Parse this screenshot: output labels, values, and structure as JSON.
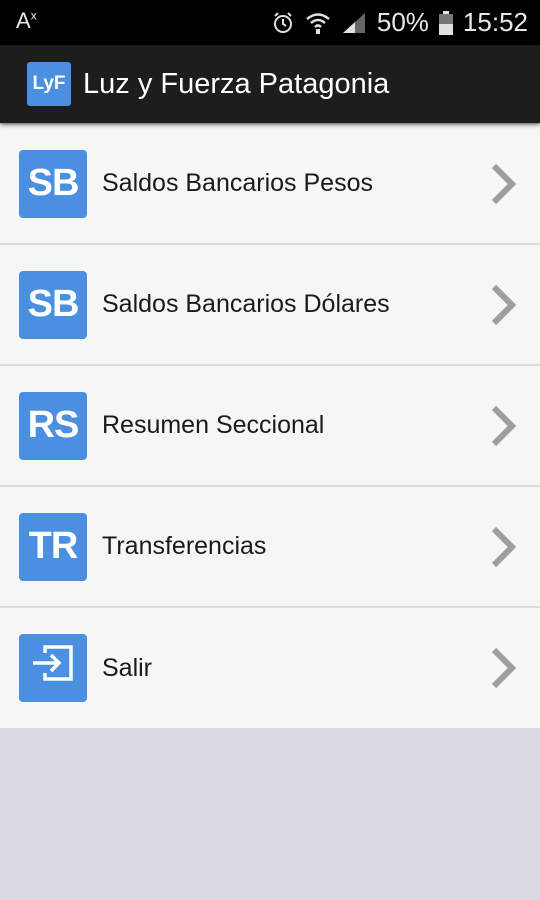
{
  "status_bar": {
    "left_indicator": "A",
    "left_indicator_sup": "x",
    "battery": "50%",
    "time": "15:52",
    "icons": [
      "alarm-icon",
      "wifi-icon",
      "signal-icon",
      "battery-icon"
    ]
  },
  "action_bar": {
    "logo_text": "LyF",
    "title": "Luz y Fuerza Patagonia"
  },
  "menu": {
    "items": [
      {
        "badge": "SB",
        "label": "Saldos Bancarios Pesos"
      },
      {
        "badge": "SB",
        "label": "Saldos Bancarios Dólares"
      },
      {
        "badge": "RS",
        "label": "Resumen Seccional"
      },
      {
        "badge": "TR",
        "label": "Transferencias"
      },
      {
        "badge": "",
        "label": "Salir",
        "icon": "exit-icon"
      }
    ]
  },
  "colors": {
    "accent": "#4a8fe0",
    "action_bar": "#1d1d1d",
    "list_background": "#f6f6f6",
    "page_background": "#dcdae2",
    "chevron": "#9e9e9e"
  }
}
